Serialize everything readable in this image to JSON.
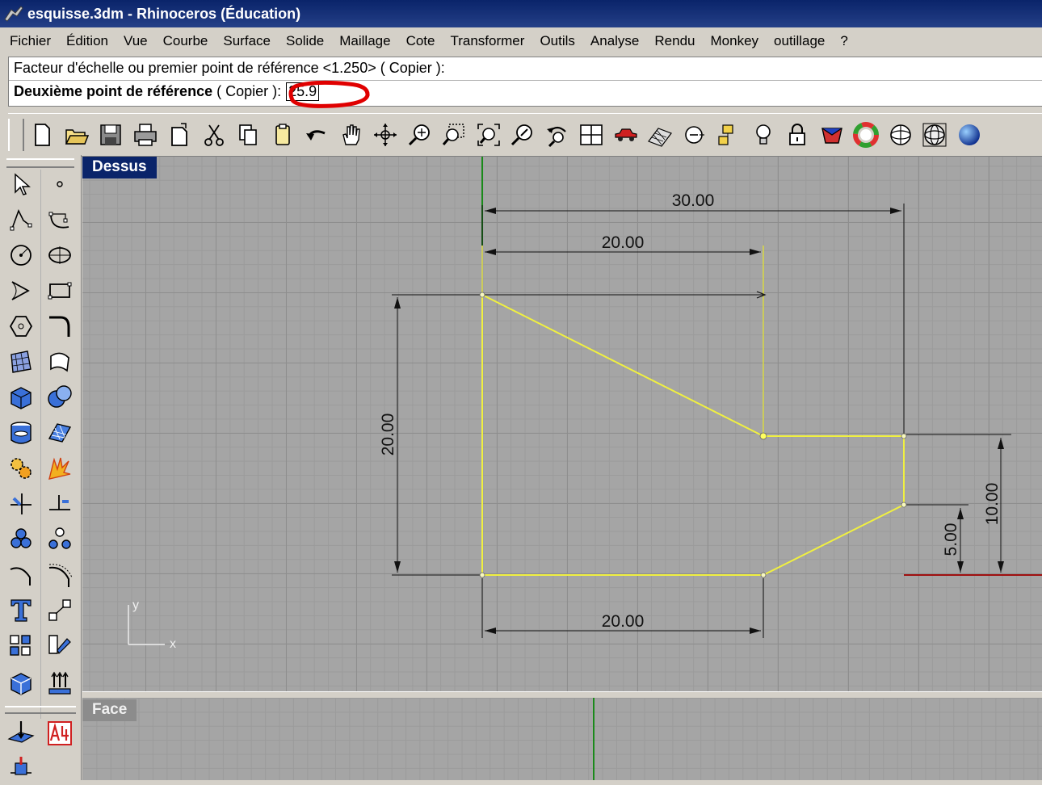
{
  "window": {
    "title": "esquisse.3dm - Rhinoceros (Éducation)"
  },
  "menu": [
    "Fichier",
    "Édition",
    "Vue",
    "Courbe",
    "Surface",
    "Solide",
    "Maillage",
    "Cote",
    "Transformer",
    "Outils",
    "Analyse",
    "Rendu",
    "Monkey",
    "outillage",
    "?"
  ],
  "command": {
    "history_line": "Facteur d'échelle ou premier point de référence <1.250> ( Copier ):",
    "prompt_bold": "Deuxième point de référence",
    "prompt_option": " ( Copier ):",
    "input_value": "25.9"
  },
  "toolbar_icons": [
    "new-file-icon",
    "open-folder-icon",
    "save-icon",
    "print-icon",
    "import-icon",
    "cut-icon",
    "copy-icon",
    "paste-icon",
    "undo-icon",
    "pan-hand-icon",
    "rotate-view-icon",
    "zoom-in-out-icon",
    "zoom-window-icon",
    "zoom-extents-icon",
    "zoom-selected-icon",
    "undo-view-icon",
    "four-viewports-icon",
    "car-camera-icon",
    "grid-snap-icon",
    "object-snap-icon",
    "layers-icon",
    "lightbulb-icon",
    "lock-icon",
    "material-icon",
    "color-wheel-icon",
    "shade-icon",
    "wireframe-sphere-icon",
    "render-sphere-icon"
  ],
  "left_toolbar_icons": [
    "select-arrow-icon",
    "point-icon",
    "polyline-icon",
    "curve-control-points-icon",
    "circle-icon",
    "ellipse-icon",
    "polygon-icon",
    "rectangle-icon",
    "arc-polygon-icon",
    "fillet-curve-icon",
    "surface-from-points-icon",
    "surface-patch-icon",
    "box-solid-icon",
    "boolean-union-icon",
    "cylinder-icon",
    "mesh-plane-icon",
    "gears-icon",
    "explode-icon",
    "trim-icon",
    "split-icon",
    "group-icon",
    "ungroup-icon",
    "offset-curve-icon",
    "array-curve-icon",
    "text-icon",
    "move-icon",
    "blocks-icon",
    "mirror-icon",
    "solid-edit-icon",
    "extrude-icon",
    "plane-icon",
    "a4-layout-icon",
    "navigation-icon"
  ],
  "viewports": {
    "top_label": "Dessus",
    "front_label": "Face"
  },
  "axes": {
    "x": "x",
    "y": "y"
  },
  "dimensions": {
    "top_total": "30.00",
    "top_inner": "20.00",
    "bottom": "20.00",
    "left_vertical": "20.00",
    "right_outer": "10.00",
    "right_inner": "5.00"
  },
  "colors": {
    "title_bar": "#0a246a",
    "viewport_bg": "#a5a5a5",
    "curve_yellow": "#f0f040",
    "annotation_red": "#e00000",
    "x_axis": "#a01010",
    "y_axis": "#1a8a1a"
  }
}
